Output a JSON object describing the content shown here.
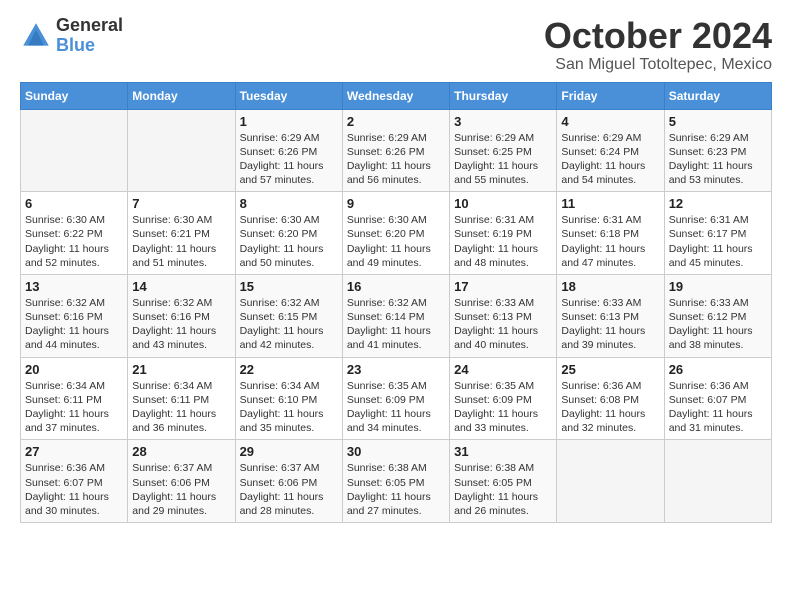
{
  "logo": {
    "general": "General",
    "blue": "Blue"
  },
  "title": {
    "month": "October 2024",
    "location": "San Miguel Totoltepec, Mexico"
  },
  "days_of_week": [
    "Sunday",
    "Monday",
    "Tuesday",
    "Wednesday",
    "Thursday",
    "Friday",
    "Saturday"
  ],
  "weeks": [
    [
      {
        "day": "",
        "info": ""
      },
      {
        "day": "",
        "info": ""
      },
      {
        "day": "1",
        "sunrise": "Sunrise: 6:29 AM",
        "sunset": "Sunset: 6:26 PM",
        "daylight": "Daylight: 11 hours and 57 minutes."
      },
      {
        "day": "2",
        "sunrise": "Sunrise: 6:29 AM",
        "sunset": "Sunset: 6:26 PM",
        "daylight": "Daylight: 11 hours and 56 minutes."
      },
      {
        "day": "3",
        "sunrise": "Sunrise: 6:29 AM",
        "sunset": "Sunset: 6:25 PM",
        "daylight": "Daylight: 11 hours and 55 minutes."
      },
      {
        "day": "4",
        "sunrise": "Sunrise: 6:29 AM",
        "sunset": "Sunset: 6:24 PM",
        "daylight": "Daylight: 11 hours and 54 minutes."
      },
      {
        "day": "5",
        "sunrise": "Sunrise: 6:29 AM",
        "sunset": "Sunset: 6:23 PM",
        "daylight": "Daylight: 11 hours and 53 minutes."
      }
    ],
    [
      {
        "day": "6",
        "sunrise": "Sunrise: 6:30 AM",
        "sunset": "Sunset: 6:22 PM",
        "daylight": "Daylight: 11 hours and 52 minutes."
      },
      {
        "day": "7",
        "sunrise": "Sunrise: 6:30 AM",
        "sunset": "Sunset: 6:21 PM",
        "daylight": "Daylight: 11 hours and 51 minutes."
      },
      {
        "day": "8",
        "sunrise": "Sunrise: 6:30 AM",
        "sunset": "Sunset: 6:20 PM",
        "daylight": "Daylight: 11 hours and 50 minutes."
      },
      {
        "day": "9",
        "sunrise": "Sunrise: 6:30 AM",
        "sunset": "Sunset: 6:20 PM",
        "daylight": "Daylight: 11 hours and 49 minutes."
      },
      {
        "day": "10",
        "sunrise": "Sunrise: 6:31 AM",
        "sunset": "Sunset: 6:19 PM",
        "daylight": "Daylight: 11 hours and 48 minutes."
      },
      {
        "day": "11",
        "sunrise": "Sunrise: 6:31 AM",
        "sunset": "Sunset: 6:18 PM",
        "daylight": "Daylight: 11 hours and 47 minutes."
      },
      {
        "day": "12",
        "sunrise": "Sunrise: 6:31 AM",
        "sunset": "Sunset: 6:17 PM",
        "daylight": "Daylight: 11 hours and 45 minutes."
      }
    ],
    [
      {
        "day": "13",
        "sunrise": "Sunrise: 6:32 AM",
        "sunset": "Sunset: 6:16 PM",
        "daylight": "Daylight: 11 hours and 44 minutes."
      },
      {
        "day": "14",
        "sunrise": "Sunrise: 6:32 AM",
        "sunset": "Sunset: 6:16 PM",
        "daylight": "Daylight: 11 hours and 43 minutes."
      },
      {
        "day": "15",
        "sunrise": "Sunrise: 6:32 AM",
        "sunset": "Sunset: 6:15 PM",
        "daylight": "Daylight: 11 hours and 42 minutes."
      },
      {
        "day": "16",
        "sunrise": "Sunrise: 6:32 AM",
        "sunset": "Sunset: 6:14 PM",
        "daylight": "Daylight: 11 hours and 41 minutes."
      },
      {
        "day": "17",
        "sunrise": "Sunrise: 6:33 AM",
        "sunset": "Sunset: 6:13 PM",
        "daylight": "Daylight: 11 hours and 40 minutes."
      },
      {
        "day": "18",
        "sunrise": "Sunrise: 6:33 AM",
        "sunset": "Sunset: 6:13 PM",
        "daylight": "Daylight: 11 hours and 39 minutes."
      },
      {
        "day": "19",
        "sunrise": "Sunrise: 6:33 AM",
        "sunset": "Sunset: 6:12 PM",
        "daylight": "Daylight: 11 hours and 38 minutes."
      }
    ],
    [
      {
        "day": "20",
        "sunrise": "Sunrise: 6:34 AM",
        "sunset": "Sunset: 6:11 PM",
        "daylight": "Daylight: 11 hours and 37 minutes."
      },
      {
        "day": "21",
        "sunrise": "Sunrise: 6:34 AM",
        "sunset": "Sunset: 6:11 PM",
        "daylight": "Daylight: 11 hours and 36 minutes."
      },
      {
        "day": "22",
        "sunrise": "Sunrise: 6:34 AM",
        "sunset": "Sunset: 6:10 PM",
        "daylight": "Daylight: 11 hours and 35 minutes."
      },
      {
        "day": "23",
        "sunrise": "Sunrise: 6:35 AM",
        "sunset": "Sunset: 6:09 PM",
        "daylight": "Daylight: 11 hours and 34 minutes."
      },
      {
        "day": "24",
        "sunrise": "Sunrise: 6:35 AM",
        "sunset": "Sunset: 6:09 PM",
        "daylight": "Daylight: 11 hours and 33 minutes."
      },
      {
        "day": "25",
        "sunrise": "Sunrise: 6:36 AM",
        "sunset": "Sunset: 6:08 PM",
        "daylight": "Daylight: 11 hours and 32 minutes."
      },
      {
        "day": "26",
        "sunrise": "Sunrise: 6:36 AM",
        "sunset": "Sunset: 6:07 PM",
        "daylight": "Daylight: 11 hours and 31 minutes."
      }
    ],
    [
      {
        "day": "27",
        "sunrise": "Sunrise: 6:36 AM",
        "sunset": "Sunset: 6:07 PM",
        "daylight": "Daylight: 11 hours and 30 minutes."
      },
      {
        "day": "28",
        "sunrise": "Sunrise: 6:37 AM",
        "sunset": "Sunset: 6:06 PM",
        "daylight": "Daylight: 11 hours and 29 minutes."
      },
      {
        "day": "29",
        "sunrise": "Sunrise: 6:37 AM",
        "sunset": "Sunset: 6:06 PM",
        "daylight": "Daylight: 11 hours and 28 minutes."
      },
      {
        "day": "30",
        "sunrise": "Sunrise: 6:38 AM",
        "sunset": "Sunset: 6:05 PM",
        "daylight": "Daylight: 11 hours and 27 minutes."
      },
      {
        "day": "31",
        "sunrise": "Sunrise: 6:38 AM",
        "sunset": "Sunset: 6:05 PM",
        "daylight": "Daylight: 11 hours and 26 minutes."
      },
      {
        "day": "",
        "info": ""
      },
      {
        "day": "",
        "info": ""
      }
    ]
  ]
}
